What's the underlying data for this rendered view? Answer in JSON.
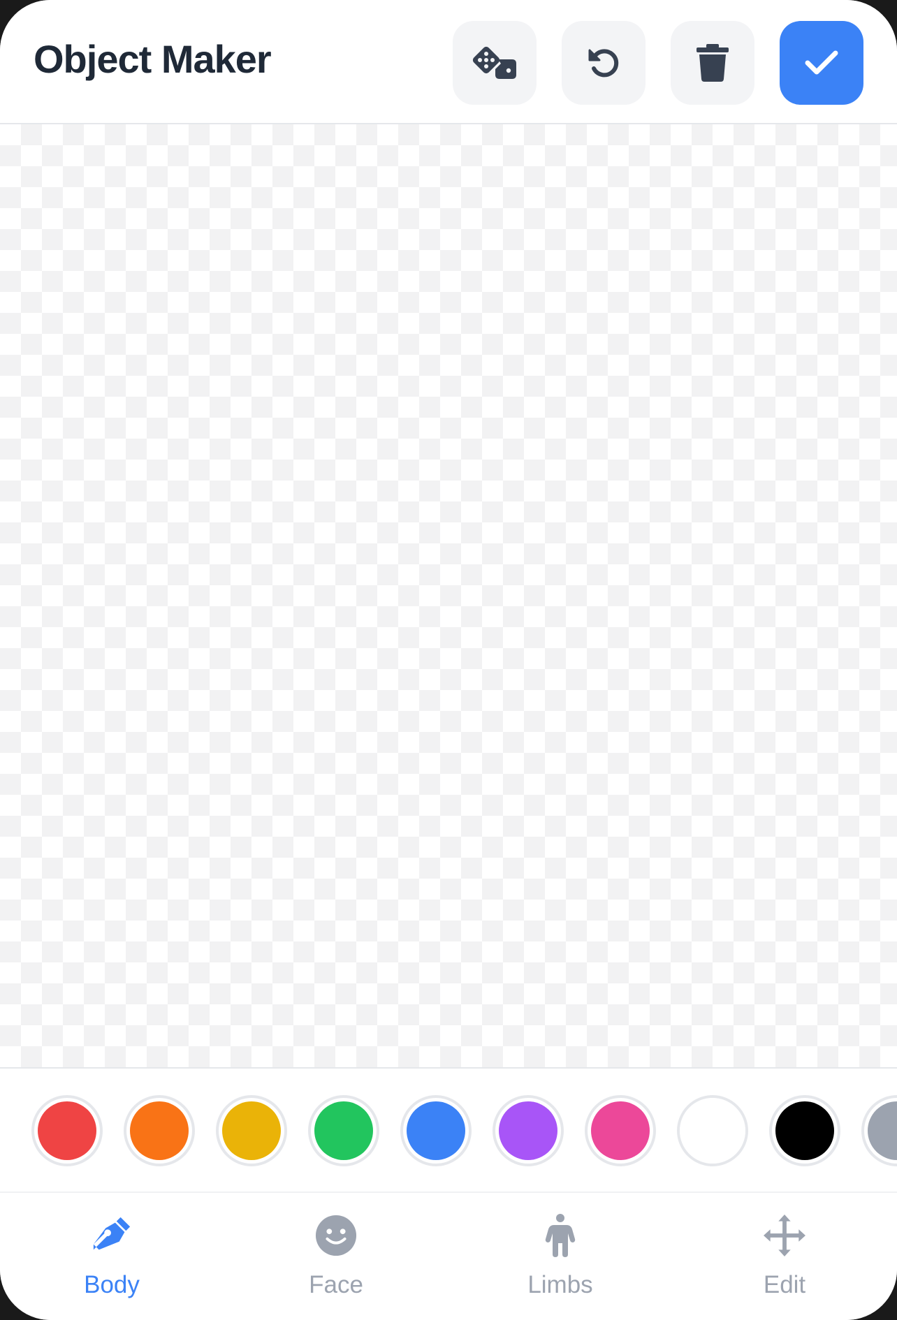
{
  "header": {
    "title": "Object Maker",
    "buttons": [
      {
        "id": "random",
        "icon": "dice-icon"
      },
      {
        "id": "undo",
        "icon": "undo-icon"
      },
      {
        "id": "delete",
        "icon": "trash-icon"
      },
      {
        "id": "done",
        "icon": "check-icon",
        "accent": "#3b82f6"
      }
    ]
  },
  "palette": {
    "colors": [
      {
        "name": "red",
        "hex": "#ef4444"
      },
      {
        "name": "orange",
        "hex": "#f97316"
      },
      {
        "name": "yellow",
        "hex": "#eab308"
      },
      {
        "name": "green",
        "hex": "#22c55e"
      },
      {
        "name": "blue",
        "hex": "#3b82f6"
      },
      {
        "name": "purple",
        "hex": "#a855f7"
      },
      {
        "name": "pink",
        "hex": "#ec4899"
      },
      {
        "name": "white",
        "hex": "#ffffff"
      },
      {
        "name": "black",
        "hex": "#000000"
      },
      {
        "name": "gray",
        "hex": "#9ca3af"
      }
    ]
  },
  "nav": {
    "active": "body",
    "active_color": "#3b82f6",
    "inactive_color": "#9ca3af",
    "items": [
      {
        "id": "body",
        "label": "Body",
        "icon": "pen-nib-icon"
      },
      {
        "id": "face",
        "label": "Face",
        "icon": "smiley-face-icon"
      },
      {
        "id": "limbs",
        "label": "Limbs",
        "icon": "person-icon"
      },
      {
        "id": "edit",
        "label": "Edit",
        "icon": "move-arrows-icon"
      }
    ]
  }
}
